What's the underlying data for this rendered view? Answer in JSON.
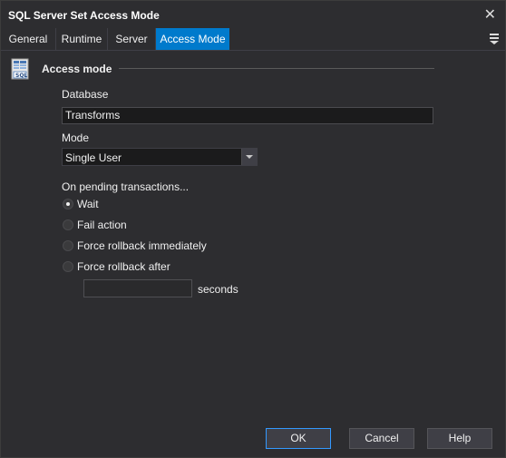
{
  "window": {
    "title": "SQL Server Set Access Mode"
  },
  "tabs": [
    {
      "label": "General"
    },
    {
      "label": "Runtime"
    },
    {
      "label": "Server"
    },
    {
      "label": "Access Mode",
      "active": true
    }
  ],
  "section": {
    "title": "Access mode",
    "icon": "sql-database-icon"
  },
  "database": {
    "label": "Database",
    "value": "Transforms"
  },
  "mode": {
    "label": "Mode",
    "value": "Single User"
  },
  "pending": {
    "label": "On pending transactions...",
    "options": [
      {
        "label": "Wait",
        "checked": true
      },
      {
        "label": "Fail action",
        "checked": false
      },
      {
        "label": "Force rollback immediately",
        "checked": false
      },
      {
        "label": "Force rollback after",
        "checked": false
      }
    ],
    "seconds_value": "",
    "seconds_label": "seconds"
  },
  "buttons": {
    "ok": "OK",
    "cancel": "Cancel",
    "help": "Help"
  },
  "colors": {
    "accent": "#007acc",
    "background": "#2d2d30",
    "input": "#1b1b1c"
  }
}
